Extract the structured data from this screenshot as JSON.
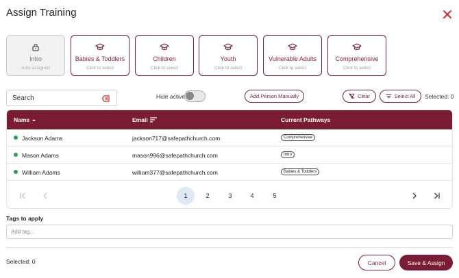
{
  "dialog": {
    "title": "Assign Training"
  },
  "colors": {
    "accent": "#7a1c33",
    "active_dot": "#2e9e4a",
    "close": "#d42a2a",
    "active_page_bg": "#dfe8f3"
  },
  "pathways": [
    {
      "label": "Intro",
      "subtitle": "Auto-assigned",
      "icon": "lock-icon",
      "disabled": true
    },
    {
      "label": "Babies & Toddlers",
      "subtitle": "Click to select",
      "icon": "graduation-cap-icon"
    },
    {
      "label": "Children",
      "subtitle": "Click to select",
      "icon": "graduation-cap-icon"
    },
    {
      "label": "Youth",
      "subtitle": "Click to select",
      "icon": "graduation-cap-icon"
    },
    {
      "label": "Vulnerable Adults",
      "subtitle": "Click to select",
      "icon": "graduation-cap-icon"
    },
    {
      "label": "Comprehensive",
      "subtitle": "Click to select",
      "icon": "graduation-cap-icon"
    }
  ],
  "search": {
    "value": "Search"
  },
  "filters": {
    "hide_active_label": "Hide active",
    "hide_active_on": false,
    "add_person_label": "Add Person Manually",
    "clear_label": "Clear",
    "select_all_label": "Select All",
    "selected_count_label": "Selected: 0"
  },
  "table": {
    "columns": [
      "Name",
      "Email",
      "Current Pathways"
    ],
    "rows": [
      {
        "name": "Jackson Adams",
        "email": "jackson717@safepathchurch.com",
        "pathway": "Comprehensive"
      },
      {
        "name": "Mason Adams",
        "email": "mason996@safepathchurch.com",
        "pathway": "Intro"
      },
      {
        "name": "William Adams",
        "email": "william377@safepathchurch.com",
        "pathway": "Babies & Toddlers"
      }
    ]
  },
  "pagination": {
    "pages": [
      "1",
      "2",
      "3",
      "4",
      "5"
    ],
    "current": "1"
  },
  "tags": {
    "label": "Tags to apply",
    "placeholder": "Add tag..."
  },
  "footer": {
    "selected_label": "Selected: 0",
    "cancel_label": "Cancel",
    "save_label": "Save & Assign"
  }
}
